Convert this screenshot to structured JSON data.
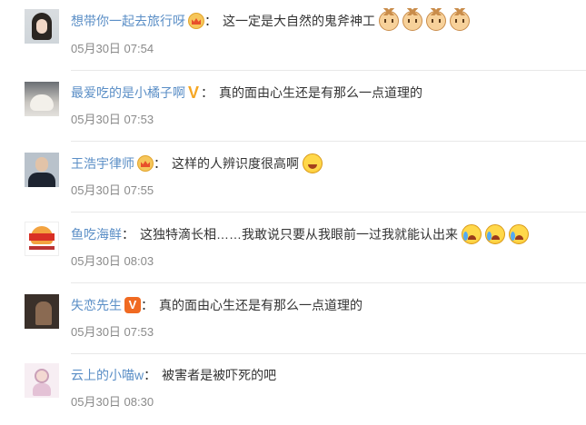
{
  "comments": [
    {
      "username": "想带你一起去旅行呀",
      "badge": "vip-crown",
      "colon": "：",
      "text": "这一定是大自然的鬼斧神工",
      "emojis": [
        "cat-emoji",
        "cat-emoji",
        "cat-emoji",
        "cat-emoji"
      ],
      "time": "05月30日 07:54"
    },
    {
      "username": "最爱吃的是小橘子啊",
      "badge": "gold-v",
      "colon": "：",
      "text": "真的面由心生还是有那么一点道理的",
      "emojis": [],
      "time": "05月30日 07:53"
    },
    {
      "username": "王浩宇律师",
      "badge": "vip-crown",
      "colon": "：",
      "text": "这样的人辨识度很高啊",
      "emojis": [
        "laugh-emoji"
      ],
      "time": "05月30日 07:55"
    },
    {
      "username": "鱼吃海鲜",
      "badge": "",
      "colon": "：",
      "text": "这独特滴长相……我敢说只要从我眼前一过我就能认出来",
      "emojis": [
        "cry-laugh-emoji",
        "cry-laugh-emoji",
        "cry-laugh-emoji"
      ],
      "time": "05月30日 08:03"
    },
    {
      "username": "失恋先生",
      "badge": "orange-v",
      "colon": "：",
      "text": "真的面由心生还是有那么一点道理的",
      "emojis": [],
      "time": "05月30日 07:53"
    },
    {
      "username": "云上的小喵w",
      "badge": "",
      "colon": "：",
      "text": "被害者是被吓死的吧",
      "emojis": [],
      "time": "05月30日 08:30"
    }
  ],
  "badge_labels": {
    "v": "V"
  },
  "colors": {
    "username": "#5a8ec6",
    "text": "#333333",
    "time": "#8a8a8a",
    "divider": "#e8e8e8"
  }
}
